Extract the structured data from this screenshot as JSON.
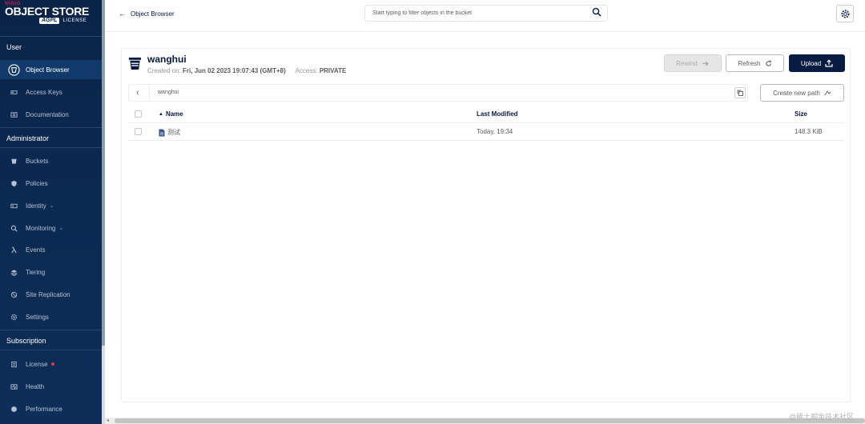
{
  "brand": {
    "vendor": "MINIO",
    "product": "OBJECT STORE",
    "license_badge": "AGPL",
    "license_text": "LICENSE"
  },
  "sidebar": {
    "sections": [
      {
        "title": "User",
        "items": [
          {
            "label": "Object Browser",
            "icon": "bucket-circle-icon",
            "active": true
          },
          {
            "label": "Access Keys",
            "icon": "key-icon"
          },
          {
            "label": "Documentation",
            "icon": "docs-icon"
          }
        ]
      },
      {
        "title": "Administrator",
        "items": [
          {
            "label": "Buckets",
            "icon": "bucket-icon"
          },
          {
            "label": "Policies",
            "icon": "shield-icon"
          },
          {
            "label": "Identity",
            "icon": "id-card-icon",
            "chevron": "⌄"
          },
          {
            "label": "Monitoring",
            "icon": "search-icon",
            "chevron": "⌄"
          },
          {
            "label": "Events",
            "icon": "lambda-icon"
          },
          {
            "label": "Tiering",
            "icon": "layers-icon"
          },
          {
            "label": "Site Replication",
            "icon": "replication-icon"
          },
          {
            "label": "Settings",
            "icon": "gear-icon"
          }
        ]
      },
      {
        "title": "Subscription",
        "items": [
          {
            "label": "License",
            "icon": "license-icon",
            "alert_dot": true
          },
          {
            "label": "Health",
            "icon": "health-icon"
          },
          {
            "label": "Performance",
            "icon": "performance-icon"
          }
        ]
      }
    ]
  },
  "topbar": {
    "back_label": "Object Browser",
    "search_placeholder": "Start typing to filter objects in the bucket"
  },
  "bucket": {
    "name": "wanghui",
    "created_label": "Created on:",
    "created_value": "Fri, Jun 02 2023 19:07:43 (GMT+8)",
    "access_label": "Access:",
    "access_value": "PRIVATE"
  },
  "actions": {
    "rewind": "Rewind",
    "refresh": "Refresh",
    "upload": "Upload",
    "create_path": "Create new path"
  },
  "path": {
    "crumb": "wanghui"
  },
  "table": {
    "headers": {
      "name": "Name",
      "modified": "Last Modified",
      "size": "Size"
    },
    "sort_indicator": "▲",
    "rows": [
      {
        "name": "测试",
        "modified": "Today, 19:34",
        "size": "148.3 KiB"
      }
    ]
  },
  "watermark": "@稀土掘金技术社区",
  "colors": {
    "sidebar_bg": "#0b2a52",
    "primary": "#081c42",
    "alert": "#e0373f"
  }
}
